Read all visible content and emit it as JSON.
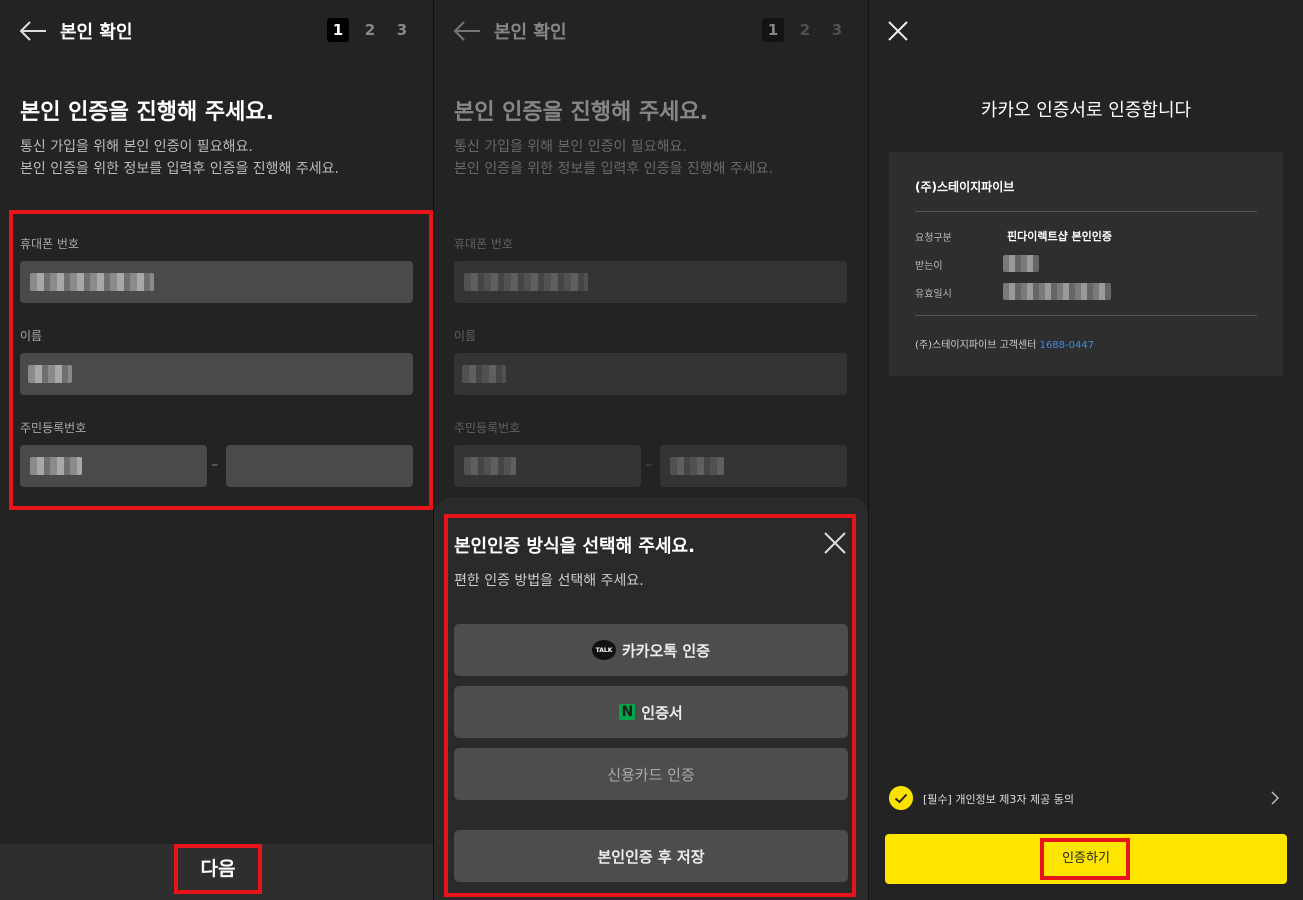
{
  "panel1": {
    "header": {
      "title": "본인 확인",
      "steps": [
        "1",
        "2",
        "3"
      ],
      "active_step": "1"
    },
    "heading": "본인 인증을 진행해 주세요.",
    "desc_line1": "통신 가입을 위해 본인 인증이 필요해요.",
    "desc_line2": "본인 인증을 위한 정보를 입력후 인증을 진행해 주세요.",
    "fields": {
      "phone_label": "휴대폰 번호",
      "name_label": "이름",
      "rrn_label": "주민등록번호",
      "rrn_separator": "–"
    },
    "next_label": "다음"
  },
  "panel2": {
    "header": {
      "title": "본인 확인",
      "steps": [
        "1",
        "2",
        "3"
      ]
    },
    "heading": "본인 인증을 진행해 주세요.",
    "desc_line1": "통신 가입을 위해 본인 인증이 필요해요.",
    "desc_line2": "본인 인증을 위한 정보를 입력후 인증을 진행해 주세요.",
    "fields": {
      "phone_label": "휴대폰 번호",
      "name_label": "이름",
      "rrn_label": "주민등록번호",
      "rrn_separator": "–"
    },
    "sheet": {
      "title": "본인인증 방식을 선택해 주세요.",
      "desc": "편한 인증 방법을 선택해 주세요.",
      "kakao_label": "카카오톡 인증",
      "kakao_icon_text": "TALK",
      "naver_label": "인증서",
      "naver_icon_text": "N",
      "card_label": "신용카드 인증",
      "save_label": "본인인증 후 저장"
    }
  },
  "panel3": {
    "title": "카카오 인증서로 인증합니다",
    "card": {
      "company": "(주)스테이지파이브",
      "request_type_key": "요청구분",
      "request_type_val": "핀다이렉트샵 본인인증",
      "recipient_key": "받는이",
      "validity_key": "유효일시",
      "contact_prefix": "(주)스테이지파이브 고객센터",
      "contact_phone": "1688-0447"
    },
    "consent_text": "[필수] 개인정보 제3자 제공 동의",
    "auth_label": "인증하기"
  },
  "colors": {
    "highlight": "#e8141c",
    "kakao_yellow": "#fee500",
    "link_blue": "#3d8ee0",
    "naver_green": "#06a44a"
  }
}
